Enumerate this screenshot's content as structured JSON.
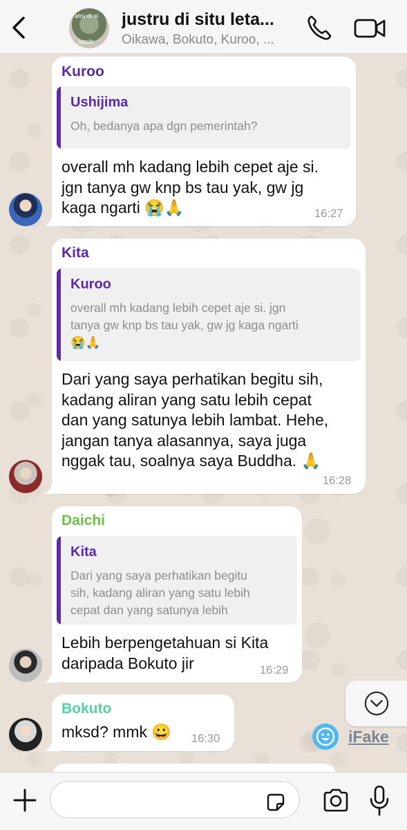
{
  "header": {
    "title": "justru di situ leta...",
    "subtitle": "Oikawa, Bokuto, Kuroo, ...",
    "avatar_text_top": "atru di si",
    "avatar_text_bottom": "kasih"
  },
  "messages": [
    {
      "sender": "Kuroo",
      "sender_color": "#5a2aa8",
      "quote": {
        "name": "Ushijima",
        "text": "Oh, bedanya apa dgn pemerintah?"
      },
      "text": "overall mh kadang lebih cepet aje si.\njgn tanya gw knp bs tau yak, gw jg\nkaga ngarti 😭🙏",
      "time": "16:27"
    },
    {
      "sender": "Kita",
      "sender_color": "#5a2aa8",
      "quote": {
        "name": "Kuroo",
        "text_lines": [
          "overall mh kadang lebih cepet aje si. jgn",
          "tanya gw knp bs tau yak, gw jg kaga ngarti",
          "😭🙏"
        ]
      },
      "text": "Dari yang saya perhatikan begitu sih,\nkadang aliran yang satu lebih cepat\ndan yang satunya lebih lambat. Hehe,\njangan tanya alasannya, saya juga\nnggak tau, soalnya saya Buddha. 🙏",
      "time": "16:28"
    },
    {
      "sender": "Daichi",
      "sender_color": "#6cc04a",
      "quote": {
        "name": "Kita",
        "text_lines": [
          "Dari yang saya perhatikan begitu",
          "sih, kadang aliran yang satu lebih",
          "cepat dan yang satunya lebih"
        ]
      },
      "text": "Lebih berpengetahuan si Kita\ndaripada Bokuto jir",
      "time": "16:29"
    },
    {
      "sender": "Bokuto",
      "sender_color": "#4fd6a0",
      "text": "mksd? mmk 😀",
      "time": "16:30"
    }
  ],
  "watermark": "iFake",
  "composer": {
    "placeholder": ""
  },
  "colors": {
    "header_bg": "#f6f6f6",
    "wallpaper": "#e9e1d8",
    "bubble": "#ffffff",
    "quote_bar": "#5a2aa8"
  }
}
